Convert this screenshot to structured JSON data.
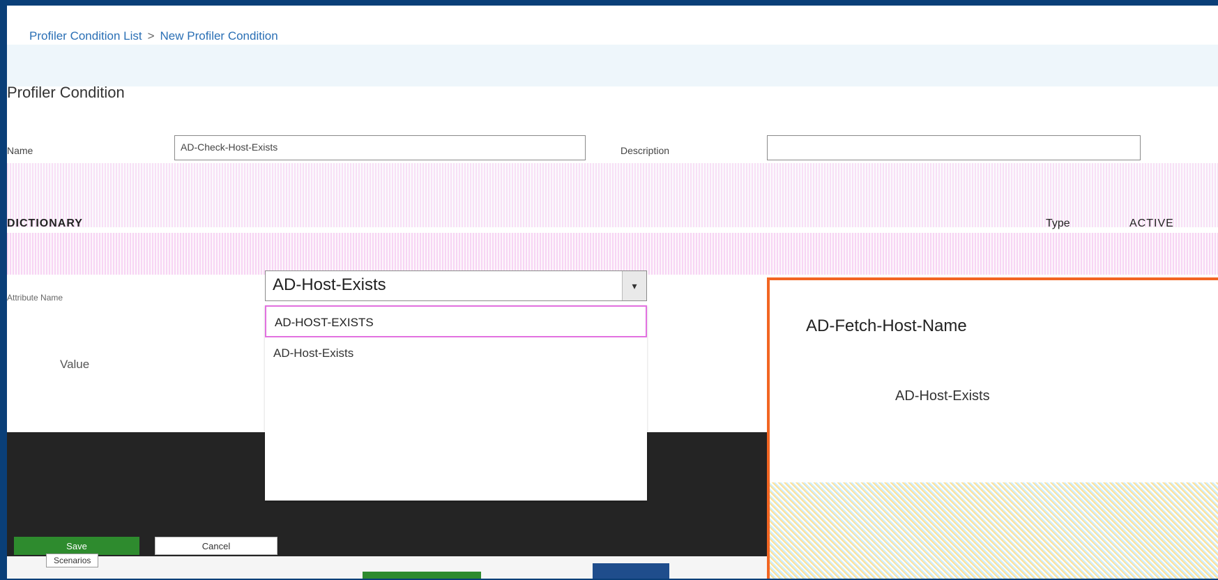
{
  "breadcrumb": {
    "items": [
      "Profiler Condition List",
      "New Profiler Condition"
    ],
    "separator": ">"
  },
  "page": {
    "title": "Profiler Condition"
  },
  "form": {
    "name_label": "Name",
    "name_value": "AD-Check-Host-Exists",
    "description_label": "Description",
    "description_value": "",
    "dictionary_label": "DICTIONARY",
    "type_label": "Type",
    "type_value": "ACTIVE",
    "attribute_label": "Attribute Name",
    "value_label": "Value",
    "attribute_value": "AD-Host-Exists"
  },
  "dropdown": {
    "items": [
      {
        "label": "AD-HOST-EXISTS",
        "selected": true
      },
      {
        "label": "AD-Host-Exists",
        "selected": false
      },
      {
        "label": "",
        "selected": false
      },
      {
        "label": "",
        "selected": false
      },
      {
        "label": "",
        "selected": false
      }
    ]
  },
  "popup": {
    "title": "AD-Fetch-Host-Name",
    "option": "AD-Host-Exists"
  },
  "actions": {
    "save": "Save",
    "cancel": "Cancel"
  },
  "bottom": {
    "tab": "Scenarios"
  },
  "colors": {
    "accent": "#2a6fb5",
    "highlight_border": "#e271e0",
    "popup_border": "#f26522",
    "footer_dark": "#242424",
    "save_green": "#2e8b2e"
  }
}
